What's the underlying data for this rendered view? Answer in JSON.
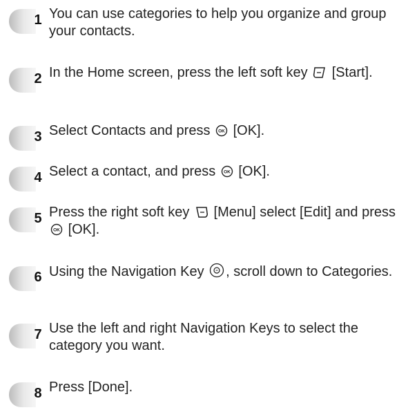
{
  "steps": [
    {
      "number": "1",
      "text": "You can use categories to help you organize and group your contacts."
    },
    {
      "number": "2",
      "text_before": "In the Home screen, press the left soft key",
      "icon": "left-soft-key-icon",
      "text_after": "[Start]."
    },
    {
      "number": "3",
      "text_before": "Select Contacts and press",
      "icon": "ok-key-icon",
      "text_after": "[OK]."
    },
    {
      "number": "4",
      "text_before": "Select a contact, and press",
      "icon": "ok-key-icon",
      "text_after": "[OK]."
    },
    {
      "number": "5",
      "text_before": "Press the right soft key",
      "icon": "right-soft-key-icon",
      "text_mid": "[Menu] select [Edit] and press",
      "icon2": "ok-key-icon",
      "text_after": "[OK]."
    },
    {
      "number": "6",
      "text_before": "Using the Navigation Key",
      "icon": "navigation-key-icon",
      "text_after": ", scroll down to Categories."
    },
    {
      "number": "7",
      "text": "Use the left and right Navigation Keys to select the category you want."
    },
    {
      "number": "8",
      "text": "Press [Done]."
    }
  ],
  "colors": {
    "badge_light": "#e9e9e9",
    "badge_dark": "#8a8a8a",
    "text": "#222222"
  }
}
